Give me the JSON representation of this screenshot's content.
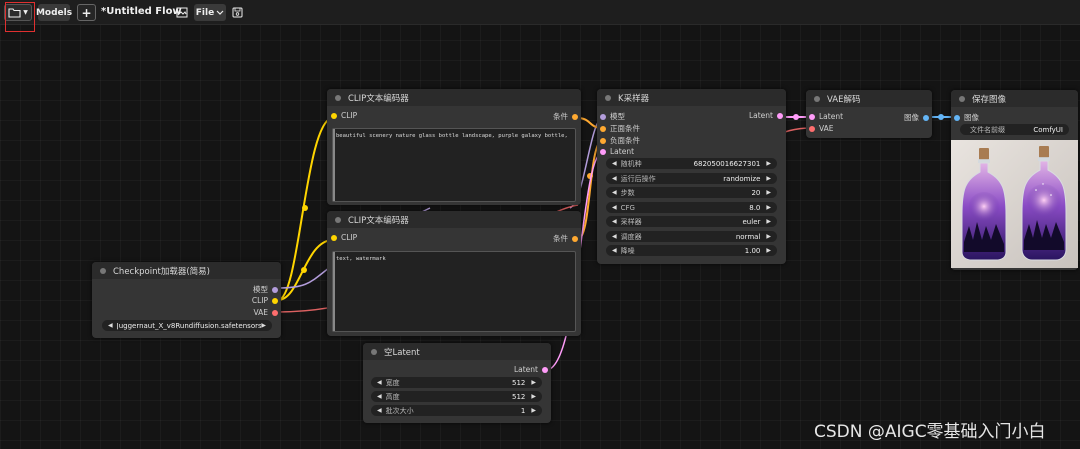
{
  "toolbar": {
    "models_label": "Models",
    "add_label": "+",
    "flow_title": "*Untitled Flow",
    "file_label": "File"
  },
  "nodes": {
    "checkpoint": {
      "title": "Checkpoint加载器(简易)",
      "outputs": [
        "模型",
        "CLIP",
        "VAE"
      ],
      "ckpt_name": "Juggernaut_X_v8Rundiffusion.safetensors"
    },
    "clip_pos": {
      "title": "CLIP文本编码器",
      "input": "CLIP",
      "output": "条件",
      "text": "beautiful scenery nature glass bottle landscape, purple galaxy bottle,"
    },
    "clip_neg": {
      "title": "CLIP文本编码器",
      "input": "CLIP",
      "output": "条件",
      "text": "text, watermark"
    },
    "ksampler": {
      "title": "K采样器",
      "inputs": [
        "模型",
        "正面条件",
        "负面条件",
        "Latent"
      ],
      "output": "Latent",
      "widgets": [
        {
          "label": "随机种",
          "value": "682050016627301"
        },
        {
          "label": "运行后操作",
          "value": "randomize"
        },
        {
          "label": "步数",
          "value": "20"
        },
        {
          "label": "CFG",
          "value": "8.0"
        },
        {
          "label": "采样器",
          "value": "euler"
        },
        {
          "label": "调度器",
          "value": "normal"
        },
        {
          "label": "降噪",
          "value": "1.00"
        }
      ]
    },
    "vae_decode": {
      "title": "VAE解码",
      "inputs": [
        "Latent",
        "VAE"
      ],
      "output": "图像"
    },
    "save_image": {
      "title": "保存图像",
      "input": "图像",
      "prefix_label": "文件名前缀",
      "prefix_value": "ComfyUI"
    },
    "empty_latent": {
      "title": "空Latent",
      "output": "Latent",
      "widgets": [
        {
          "label": "宽度",
          "value": "512"
        },
        {
          "label": "高度",
          "value": "512"
        },
        {
          "label": "批次大小",
          "value": "1"
        }
      ]
    }
  },
  "colors": {
    "clip": "#ffd500",
    "model": "#b39ddb",
    "vae": "#ff6e6e",
    "conditioning": "#ffa931",
    "latent": "#ff9cf9",
    "image": "#64b5f6"
  },
  "watermark": "CSDN @AIGC零基础入门小白"
}
